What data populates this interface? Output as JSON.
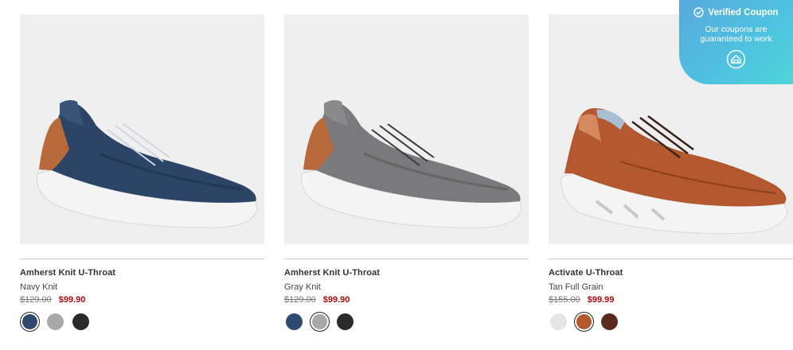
{
  "products": [
    {
      "name": "Amherst Knit U-Throat",
      "color": "Navy Knit",
      "original_price": "$129.00",
      "sale_price": "$99.90",
      "swatches": [
        {
          "name": "navy",
          "color": "#2e4a6e",
          "selected": true
        },
        {
          "name": "gray",
          "color": "#a8a8a8",
          "selected": false
        },
        {
          "name": "black",
          "color": "#2a2a2a",
          "selected": false
        }
      ]
    },
    {
      "name": "Amherst Knit U-Throat",
      "color": "Gray Knit",
      "original_price": "$129.00",
      "sale_price": "$99.90",
      "swatches": [
        {
          "name": "navy",
          "color": "#2e4a6e",
          "selected": false
        },
        {
          "name": "gray",
          "color": "#a8a8a8",
          "selected": true
        },
        {
          "name": "black",
          "color": "#2a2a2a",
          "selected": false
        }
      ]
    },
    {
      "name": "Activate U-Throat",
      "color": "Tan Full Grain",
      "original_price": "$155.00",
      "sale_price": "$99.99",
      "swatches": [
        {
          "name": "white",
          "color": "#e6e6e6",
          "selected": false
        },
        {
          "name": "tan",
          "color": "#b4582f",
          "selected": true
        },
        {
          "name": "brown",
          "color": "#5a2a20",
          "selected": false
        }
      ]
    }
  ],
  "coupon": {
    "title": "Verified Coupon",
    "line1": "Our coupons are",
    "line2": "guaranteed to work",
    "icon": "coupon-shield-icon"
  },
  "colors": {
    "sale": "#b00a0a",
    "coupon_gradient_start": "#58a9de",
    "coupon_gradient_end": "#4fd6d8"
  }
}
